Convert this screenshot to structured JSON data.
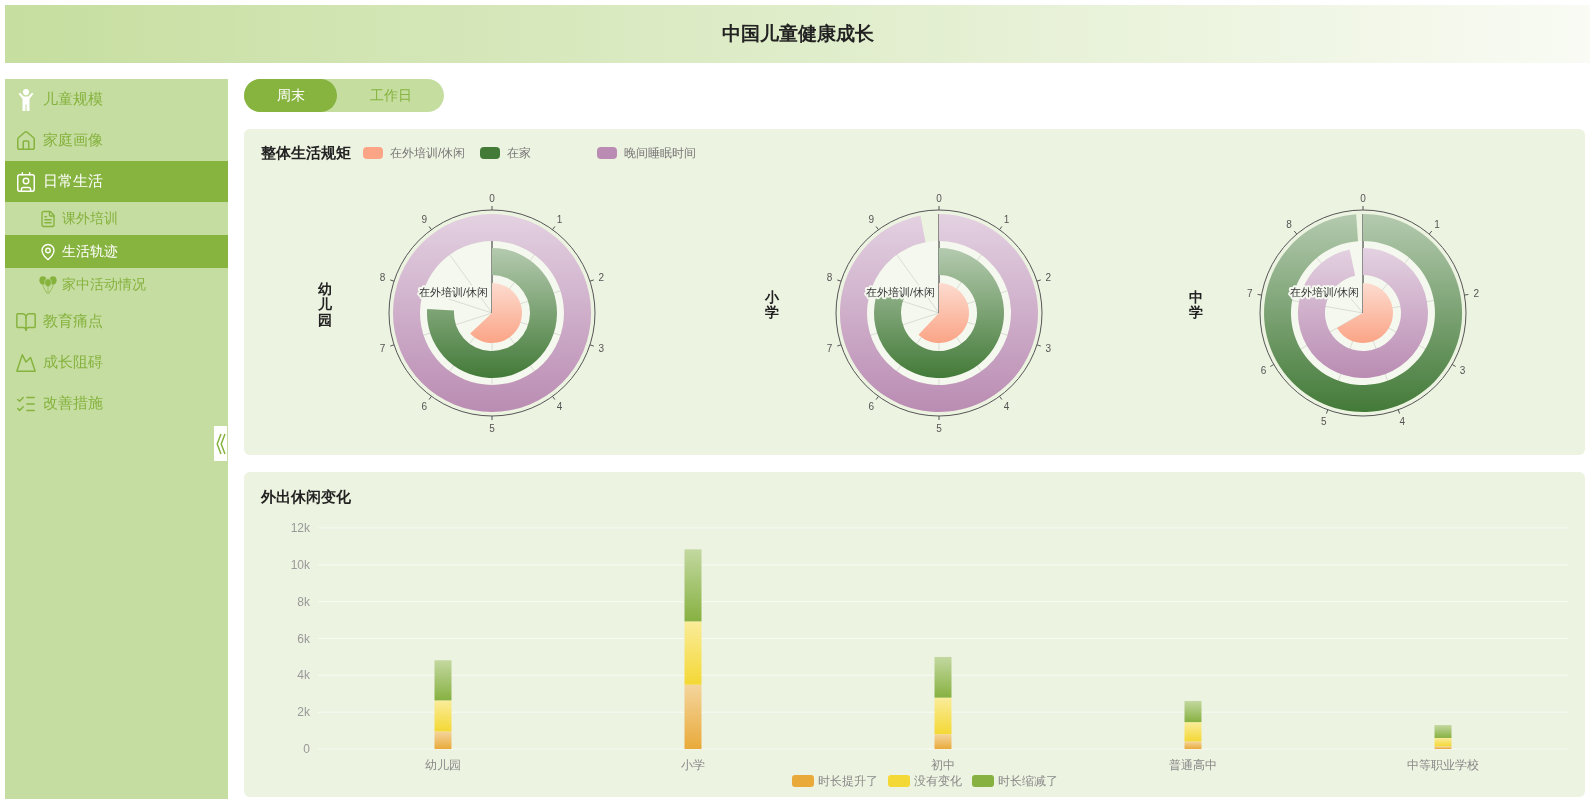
{
  "header": {
    "title": "中国儿童健康成长"
  },
  "sidebar": {
    "items": [
      {
        "label": "儿童规模",
        "selected": false
      },
      {
        "label": "家庭画像",
        "selected": false
      },
      {
        "label": "日常生活",
        "selected": true,
        "children": [
          {
            "label": "课外培训",
            "selected": false
          },
          {
            "label": "生活轨迹",
            "selected": true
          },
          {
            "label": "家中活动情况",
            "selected": false
          }
        ]
      },
      {
        "label": "教育痛点",
        "selected": false
      },
      {
        "label": "成长阻碍",
        "selected": false
      },
      {
        "label": "改善措施",
        "selected": false
      }
    ]
  },
  "tabs": [
    {
      "label": "周末",
      "selected": true
    },
    {
      "label": "工作日",
      "selected": false
    }
  ],
  "routine": {
    "title": "整体生活规矩",
    "legend": [
      {
        "label": "在外培训/休闲",
        "color": "#fba486"
      },
      {
        "label": "在家",
        "color": "#437a38"
      },
      {
        "label": "晚间睡眠时间",
        "color": "#ba8cb3"
      }
    ],
    "charts": [
      {
        "label": "幼儿园",
        "ticks": [
          "0",
          "1",
          "2",
          "3",
          "4",
          "5",
          "6",
          "7",
          "8",
          "9"
        ],
        "axis_label": "在外培训/休闲"
      },
      {
        "label": "小学",
        "ticks": [
          "0",
          "1",
          "2",
          "3",
          "4",
          "5",
          "6",
          "7",
          "8",
          "9"
        ],
        "axis_label": "在外培训/休闲"
      },
      {
        "label": "中学",
        "ticks": [
          "0",
          "1",
          "2",
          "3",
          "4",
          "5",
          "6",
          "7",
          "8"
        ],
        "axis_label": "在外培训/休闲"
      }
    ]
  },
  "leisure": {
    "title": "外出休闲变化",
    "chart_data": {
      "type": "bar",
      "stacked": true,
      "grid": true,
      "categories": [
        "幼儿园",
        "小学",
        "初中",
        "普通高中",
        "中等职业学校"
      ],
      "ylim": [
        0,
        12000
      ],
      "yticks": [
        {
          "value": 0,
          "label": "0"
        },
        {
          "value": 2000,
          "label": "2k"
        },
        {
          "value": 4000,
          "label": "4k"
        },
        {
          "value": 6000,
          "label": "6k"
        },
        {
          "value": 8000,
          "label": "8k"
        },
        {
          "value": 10000,
          "label": "10k"
        },
        {
          "value": 12000,
          "label": "12k"
        }
      ],
      "series": [
        {
          "name": "时长提升了",
          "color": "#e9aa3a",
          "values": [
            950,
            3490,
            800,
            410,
            150
          ]
        },
        {
          "name": "没有变化",
          "color": "#f4d835",
          "values": [
            1690,
            3440,
            1990,
            1050,
            450
          ]
        },
        {
          "name": "时长缩减了",
          "color": "#87b141",
          "values": [
            2180,
            3910,
            2210,
            1150,
            700
          ]
        }
      ]
    }
  }
}
